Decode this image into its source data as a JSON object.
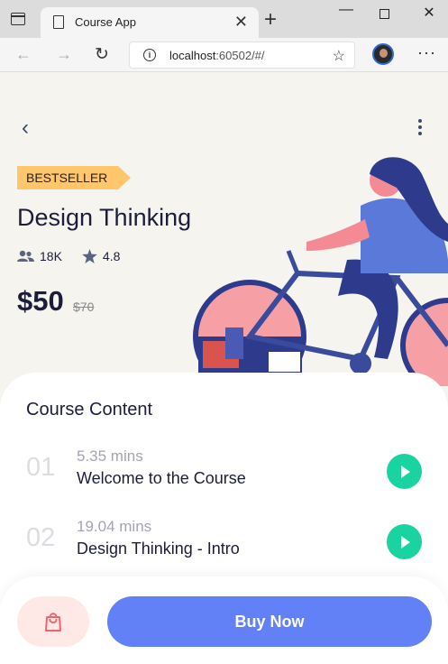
{
  "browser": {
    "tab_title": "Course App",
    "url_host": "localhost",
    "url_rest": ":60502/#/"
  },
  "course": {
    "badge": "BESTSELLER",
    "title": "Design Thinking",
    "students": "18K",
    "rating": "4.8",
    "price": "$50",
    "old_price": "$70"
  },
  "content": {
    "heading": "Course Content",
    "lessons": [
      {
        "num": "01",
        "duration": "5.35 mins",
        "name": "Welcome to the Course"
      },
      {
        "num": "02",
        "duration": "19.04 mins",
        "name": "Design Thinking - Intro"
      }
    ]
  },
  "actions": {
    "buy_label": "Buy Now"
  },
  "colors": {
    "accent": "#6381f7",
    "play": "#19d3a0",
    "badge": "#ffc66b",
    "cart_bg": "#ffe9e7"
  }
}
